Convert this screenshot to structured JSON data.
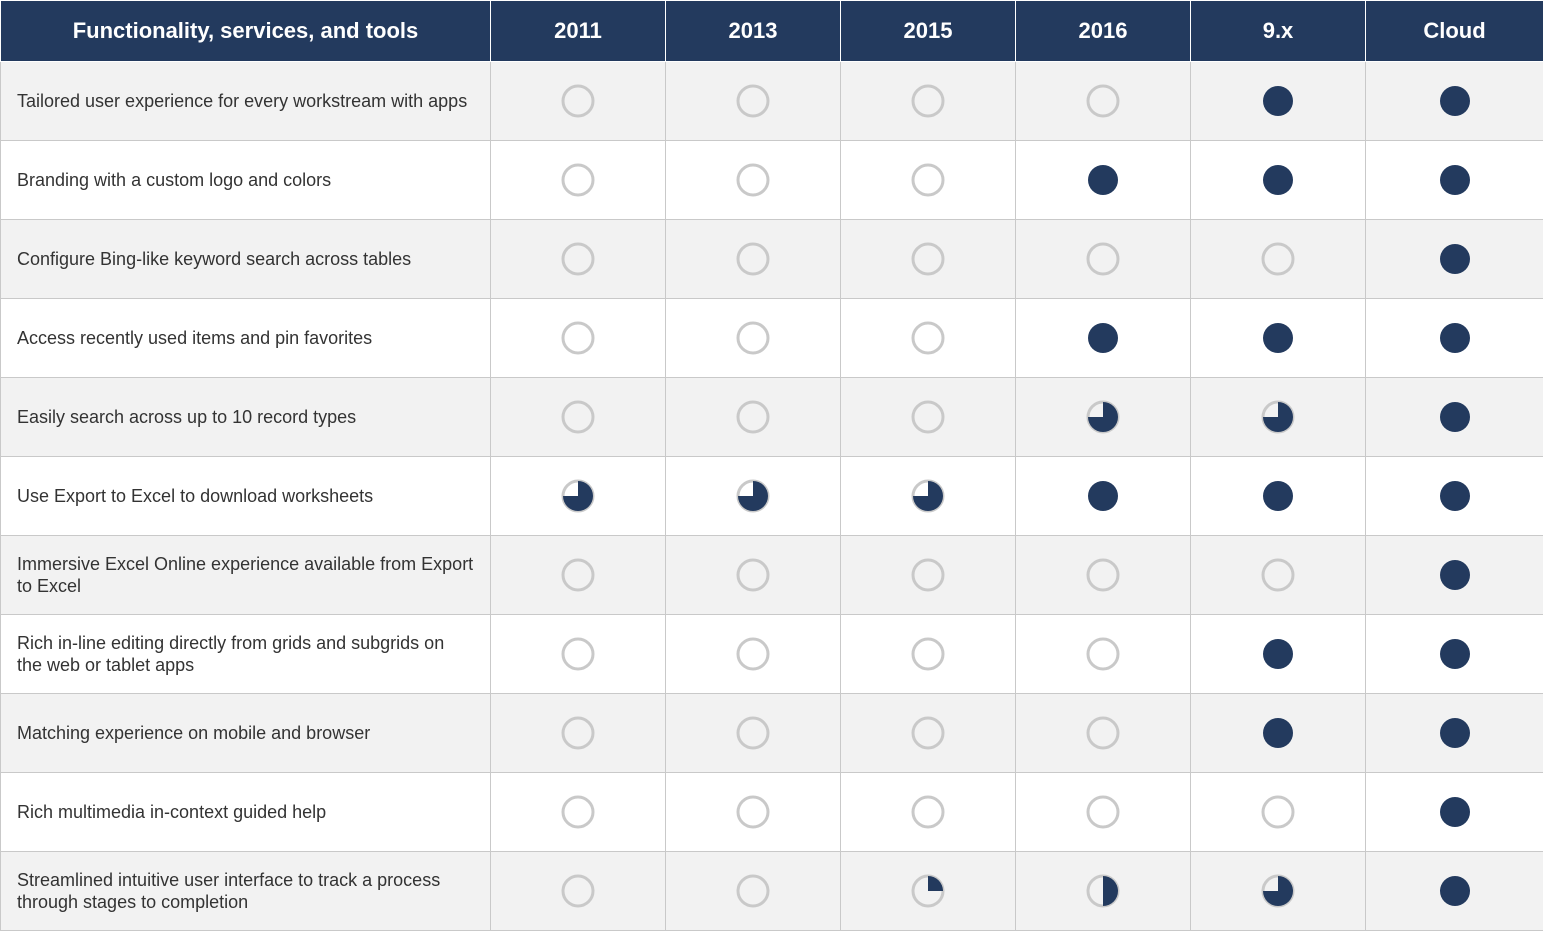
{
  "columns": [
    "Functionality, services, and tools",
    "2011",
    "2013",
    "2015",
    "2016",
    "9.x",
    "Cloud"
  ],
  "rows": [
    {
      "feature": "Tailored user experience for every workstream with apps",
      "v": [
        0,
        0,
        0,
        0,
        1,
        1
      ]
    },
    {
      "feature": "Branding with a custom logo and colors",
      "v": [
        0,
        0,
        0,
        1,
        1,
        1
      ]
    },
    {
      "feature": "Configure Bing-like keyword search across tables",
      "v": [
        0,
        0,
        0,
        0,
        0,
        1
      ]
    },
    {
      "feature": "Access recently used items and pin favorites",
      "v": [
        0,
        0,
        0,
        1,
        1,
        1
      ]
    },
    {
      "feature": "Easily search across up to 10 record types",
      "v": [
        0,
        0,
        0,
        0.75,
        0.75,
        1
      ]
    },
    {
      "feature": "Use Export to Excel to download worksheets",
      "v": [
        0.75,
        0.75,
        0.75,
        1,
        1,
        1
      ]
    },
    {
      "feature": "Immersive Excel Online experience available from Export to Excel",
      "v": [
        0,
        0,
        0,
        0,
        0,
        1
      ]
    },
    {
      "feature": "Rich in-line editing directly from grids and subgrids on the web or tablet apps",
      "v": [
        0,
        0,
        0,
        0,
        1,
        1
      ]
    },
    {
      "feature": "Matching experience on mobile and browser",
      "v": [
        0,
        0,
        0,
        0,
        1,
        1
      ]
    },
    {
      "feature": "Rich multimedia in-context guided help",
      "v": [
        0,
        0,
        0,
        0,
        0,
        1
      ]
    },
    {
      "feature": "Streamlined intuitive user interface to track a process through stages to completion",
      "v": [
        0,
        0,
        0.25,
        0.5,
        0.75,
        1
      ]
    }
  ],
  "chart_data": {
    "type": "table",
    "title": "Functionality, services, and tools — availability by version",
    "x_categories": [
      "2011",
      "2013",
      "2015",
      "2016",
      "9.x",
      "Cloud"
    ],
    "y_categories": [
      "Tailored user experience for every workstream with apps",
      "Branding with a custom logo and colors",
      "Configure Bing-like keyword search across tables",
      "Access recently used items and pin favorites",
      "Easily search across up to 10 record types",
      "Use Export to Excel to download worksheets",
      "Immersive Excel Online experience available from Export to Excel",
      "Rich in-line editing directly from grids and subgrids on the web or tablet apps",
      "Matching experience on mobile and browser",
      "Rich multimedia in-context guided help",
      "Streamlined intuitive user interface to track a process through stages to completion"
    ],
    "matrix": [
      [
        0,
        0,
        0,
        0,
        1,
        1
      ],
      [
        0,
        0,
        0,
        1,
        1,
        1
      ],
      [
        0,
        0,
        0,
        0,
        0,
        1
      ],
      [
        0,
        0,
        0,
        1,
        1,
        1
      ],
      [
        0,
        0,
        0,
        0.75,
        0.75,
        1
      ],
      [
        0.75,
        0.75,
        0.75,
        1,
        1,
        1
      ],
      [
        0,
        0,
        0,
        0,
        0,
        1
      ],
      [
        0,
        0,
        0,
        0,
        1,
        1
      ],
      [
        0,
        0,
        0,
        0,
        1,
        1
      ],
      [
        0,
        0,
        0,
        0,
        0,
        1
      ],
      [
        0,
        0,
        0.25,
        0.5,
        0.75,
        1
      ]
    ],
    "legend": {
      "0": "empty circle (not available)",
      "0.25": "quarter-filled",
      "0.5": "half-filled",
      "0.75": "three-quarter-filled",
      "1": "full circle (available)"
    }
  }
}
